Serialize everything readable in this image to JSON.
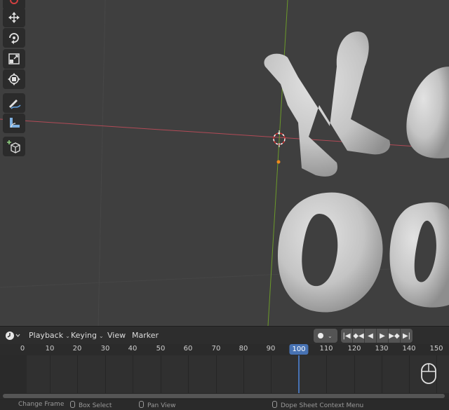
{
  "timeline": {
    "menus": [
      {
        "label": "Playback",
        "dropdown": true
      },
      {
        "label": "Keying",
        "dropdown": true
      },
      {
        "label": "View",
        "dropdown": false
      },
      {
        "label": "Marker",
        "dropdown": false
      }
    ],
    "ruler_ticks": [
      "0",
      "10",
      "20",
      "30",
      "40",
      "50",
      "60",
      "70",
      "80",
      "90",
      "100",
      "110",
      "120",
      "130",
      "140",
      "150"
    ],
    "current_frame": "100"
  },
  "status_bar": {
    "items": [
      "Change Frame",
      "Box Select",
      "Pan View",
      "Dope Sheet Context Menu"
    ]
  },
  "colors": {
    "accent": "#4772b3",
    "x_axis": "#b24b57",
    "y_axis": "#6c9a2a",
    "origin": "#f08a1c"
  },
  "tools": [
    "cursor-tool-icon",
    "move-tool-icon",
    "rotate-tool-icon",
    "scale-tool-icon",
    "transform-tool-icon",
    "annotate-tool-icon",
    "measure-tool-icon",
    "add-cube-tool-icon"
  ]
}
